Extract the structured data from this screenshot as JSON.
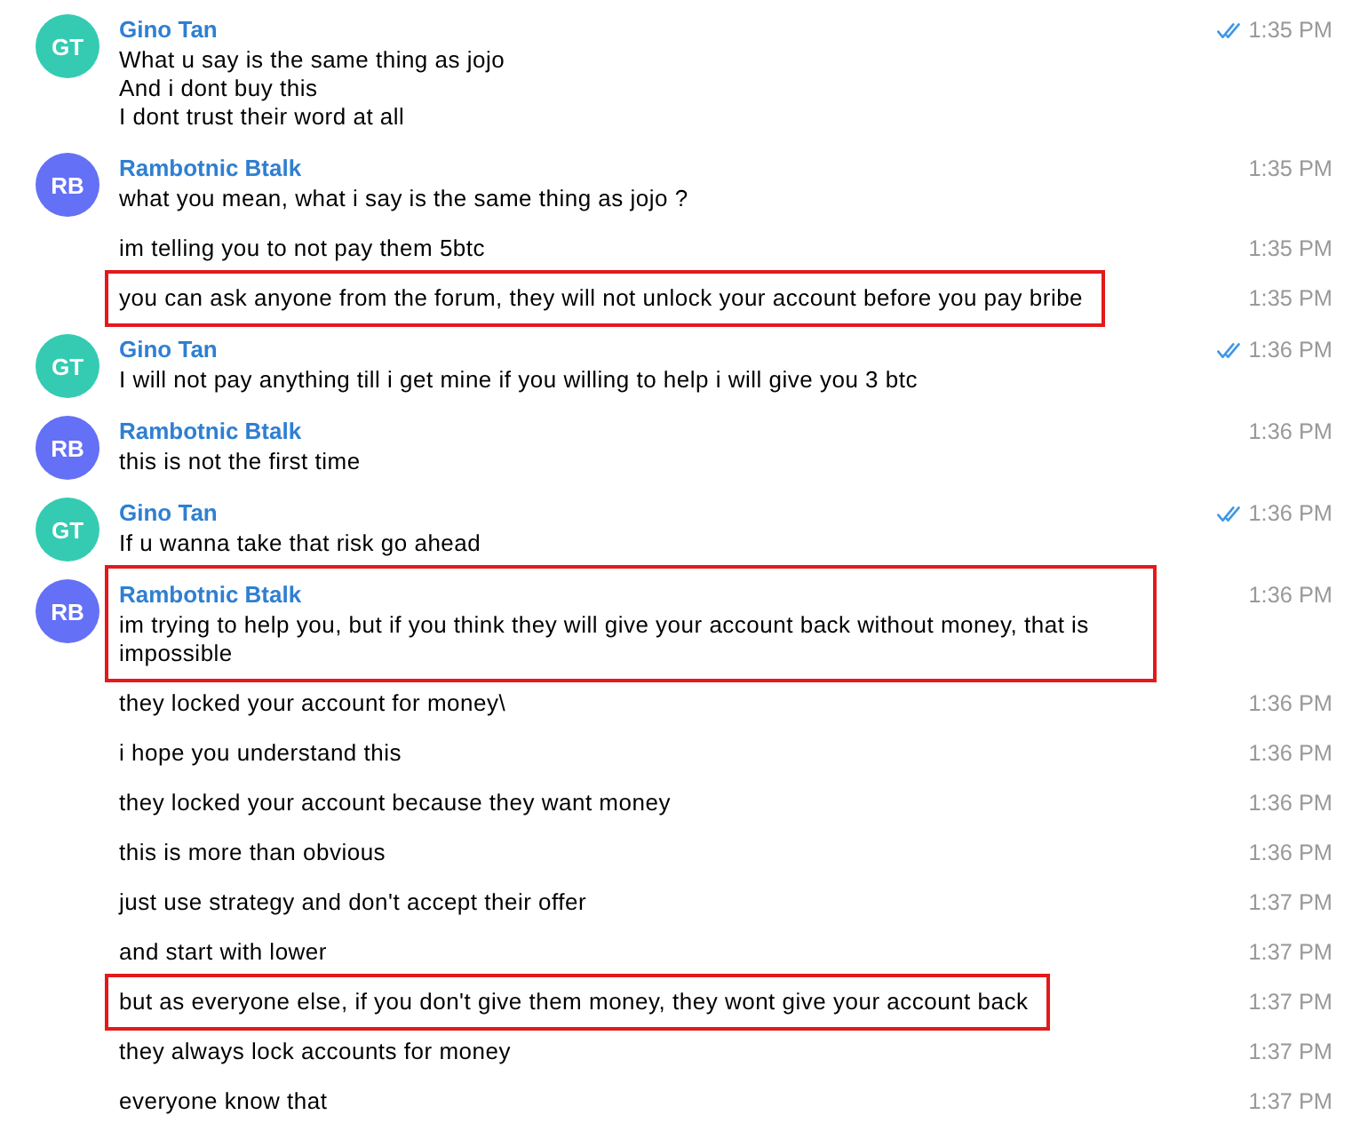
{
  "chat": {
    "groups": [
      {
        "sender": {
          "name": "Gino Tan",
          "initials": "GT",
          "color": "#34cbb2"
        },
        "messages": [
          {
            "text": "What u say is the same thing as jojo\nAnd i dont buy this\nI dont trust their word at all",
            "time": "1:35 PM",
            "read": true,
            "highlighted": false
          }
        ]
      },
      {
        "sender": {
          "name": "Rambotnic Btalk",
          "initials": "RB",
          "color": "#6470f6"
        },
        "messages": [
          {
            "text": "what you mean, what i say is the same thing as jojo ?",
            "time": "1:35 PM",
            "read": false,
            "highlighted": false
          },
          {
            "text": "im telling you to not pay them 5btc",
            "time": "1:35 PM",
            "read": false,
            "highlighted": false
          },
          {
            "text": "you can ask anyone from the forum, they will not unlock your account before you pay bribe",
            "time": "1:35 PM",
            "read": false,
            "highlighted": true
          }
        ]
      },
      {
        "sender": {
          "name": "Gino Tan",
          "initials": "GT",
          "color": "#34cbb2"
        },
        "messages": [
          {
            "text": "I will not pay anything till i get mine if you willing to help i will give you 3 btc",
            "time": "1:36 PM",
            "read": true,
            "highlighted": false
          }
        ]
      },
      {
        "sender": {
          "name": "Rambotnic Btalk",
          "initials": "RB",
          "color": "#6470f6"
        },
        "messages": [
          {
            "text": "this is not the first time",
            "time": "1:36 PM",
            "read": false,
            "highlighted": false
          }
        ]
      },
      {
        "sender": {
          "name": "Gino Tan",
          "initials": "GT",
          "color": "#34cbb2"
        },
        "messages": [
          {
            "text": "If u wanna take that risk go ahead",
            "time": "1:36 PM",
            "read": true,
            "highlighted": false
          }
        ]
      },
      {
        "sender": {
          "name": "Rambotnic Btalk",
          "initials": "RB",
          "color": "#6470f6"
        },
        "messages": [
          {
            "text": "im trying to help you, but if you think they will give your account back without money, that is impossible",
            "time": "1:36 PM",
            "read": false,
            "highlighted": true
          },
          {
            "text": "they locked your account for money\\",
            "time": "1:36 PM",
            "read": false,
            "highlighted": false
          },
          {
            "text": "i hope you understand this",
            "time": "1:36 PM",
            "read": false,
            "highlighted": false
          },
          {
            "text": "they locked your account because they want money",
            "time": "1:36 PM",
            "read": false,
            "highlighted": false
          },
          {
            "text": "this is more than obvious",
            "time": "1:36 PM",
            "read": false,
            "highlighted": false
          },
          {
            "text": "just use strategy and don't accept their offer",
            "time": "1:37 PM",
            "read": false,
            "highlighted": false
          },
          {
            "text": "and start with lower",
            "time": "1:37 PM",
            "read": false,
            "highlighted": false
          },
          {
            "text": "but as everyone else, if you don't give them money, they wont give your account back",
            "time": "1:37 PM",
            "read": false,
            "highlighted": true
          },
          {
            "text": "they always lock accounts for money",
            "time": "1:37 PM",
            "read": false,
            "highlighted": false
          },
          {
            "text": "everyone know that",
            "time": "1:37 PM",
            "read": false,
            "highlighted": false
          }
        ]
      }
    ]
  }
}
